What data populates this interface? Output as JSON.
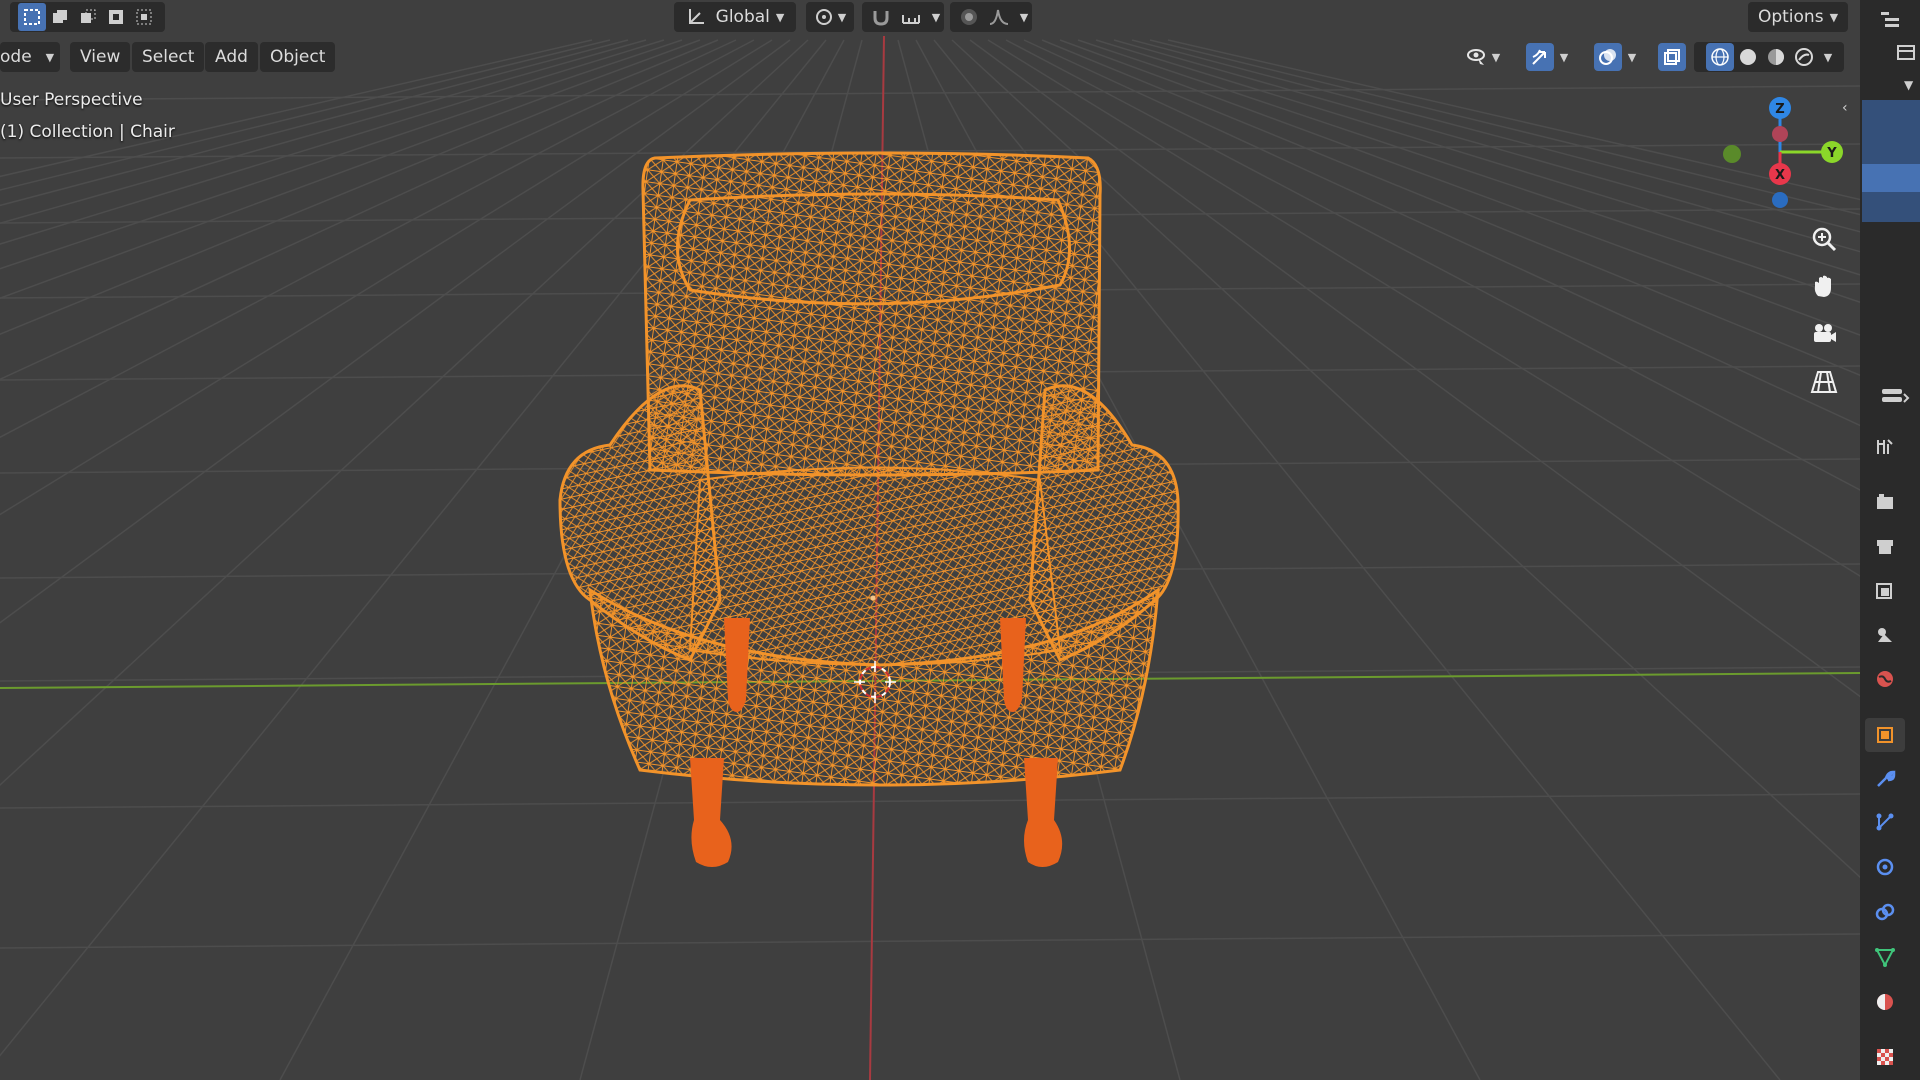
{
  "header": {
    "select_modes": [
      "select-box-new",
      "select-box-extend",
      "select-box-subtract",
      "select-box-invert",
      "select-box-intersect"
    ],
    "transform_orientation": "Global",
    "options_label": "Options"
  },
  "menu": {
    "mode_label": "ode",
    "view": "View",
    "select": "Select",
    "add": "Add",
    "object": "Object"
  },
  "viewport": {
    "perspective_label": "User Perspective",
    "collection_label": "(1) Collection | Chair",
    "object_color": "#f2932a",
    "legs_color": "#e8621c",
    "x_axis_color": "#a83a40",
    "y_axis_color": "#6b9b2e",
    "grid_color": "#4d4d4d",
    "background_color": "#3f3f3f"
  },
  "gizmo": {
    "x": "X",
    "y": "Y",
    "z": "Z",
    "x_color": "#e8374b",
    "y_color": "#8bd72a",
    "z_color": "#2f87e6"
  },
  "navigation": [
    "zoom-icon",
    "pan-hand-icon",
    "camera-icon",
    "ortho-grid-icon"
  ],
  "properties_tabs": [
    {
      "name": "tool-icon",
      "color": "#cfcfcf"
    },
    {
      "name": "render-icon",
      "color": "#cfcfcf"
    },
    {
      "name": "output-icon",
      "color": "#cfcfcf"
    },
    {
      "name": "view-layer-icon",
      "color": "#cfcfcf"
    },
    {
      "name": "scene-icon",
      "color": "#cfcfcf"
    },
    {
      "name": "world-icon",
      "color": "#d9534f"
    },
    {
      "name": "object-icon",
      "color": "#f2932a"
    },
    {
      "name": "modifier-icon",
      "color": "#5b8ff0"
    },
    {
      "name": "particles-icon",
      "color": "#5b8ff0"
    },
    {
      "name": "physics-icon",
      "color": "#5b8ff0"
    },
    {
      "name": "constraints-icon",
      "color": "#5b8ff0"
    },
    {
      "name": "data-icon",
      "color": "#3fc47a"
    },
    {
      "name": "material-icon",
      "color": "#d9534f"
    },
    {
      "name": "texture-icon",
      "color": "#d9534f"
    }
  ]
}
